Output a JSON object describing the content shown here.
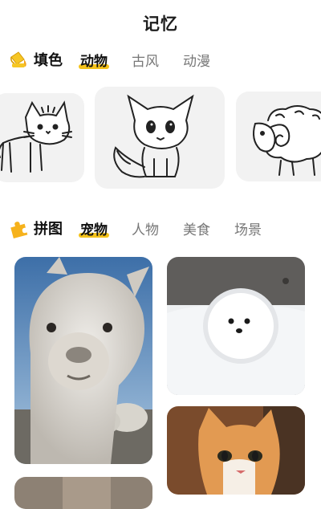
{
  "header": {
    "title": "记忆"
  },
  "coloring": {
    "title": "填色",
    "icon": "paint-bucket-icon",
    "tabs": [
      {
        "label": "动物",
        "active": true
      },
      {
        "label": "古风",
        "active": false
      },
      {
        "label": "动漫",
        "active": false
      }
    ],
    "cards": [
      "cat-outline",
      "fox-outline",
      "ram-outline"
    ]
  },
  "puzzle": {
    "title": "拼图",
    "icon": "puzzle-piece-icon",
    "tabs": [
      {
        "label": "宠物",
        "active": true
      },
      {
        "label": "人物",
        "active": false
      },
      {
        "label": "美食",
        "active": false
      },
      {
        "label": "场景",
        "active": false
      }
    ],
    "photos": [
      "alpaca-photo",
      "pomeranian-photo",
      "orange-cat-photo",
      "bottom-photo"
    ]
  },
  "colors": {
    "accent": "#f4c21a",
    "card_bg": "#f2f2f2",
    "text": "#111111",
    "muted": "#777777"
  }
}
